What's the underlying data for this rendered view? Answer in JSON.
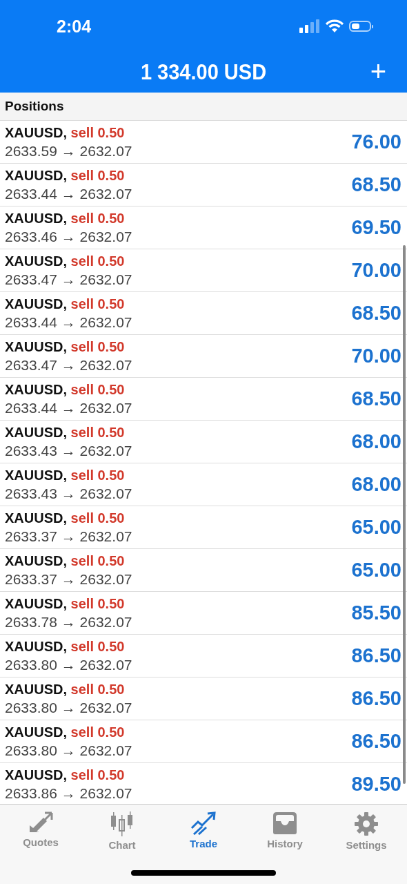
{
  "status_bar": {
    "time": "2:04"
  },
  "header": {
    "title": "1 334.00 USD",
    "add_button": "+"
  },
  "section_title": "Positions",
  "positions": [
    {
      "symbol": "XAUUSD,",
      "order": "sell 0.50",
      "prices": "2633.59 → 2632.07",
      "profit": "76.00"
    },
    {
      "symbol": "XAUUSD,",
      "order": "sell 0.50",
      "prices": "2633.44 → 2632.07",
      "profit": "68.50"
    },
    {
      "symbol": "XAUUSD,",
      "order": "sell 0.50",
      "prices": "2633.46 → 2632.07",
      "profit": "69.50"
    },
    {
      "symbol": "XAUUSD,",
      "order": "sell 0.50",
      "prices": "2633.47 → 2632.07",
      "profit": "70.00"
    },
    {
      "symbol": "XAUUSD,",
      "order": "sell 0.50",
      "prices": "2633.44 → 2632.07",
      "profit": "68.50"
    },
    {
      "symbol": "XAUUSD,",
      "order": "sell 0.50",
      "prices": "2633.47 → 2632.07",
      "profit": "70.00"
    },
    {
      "symbol": "XAUUSD,",
      "order": "sell 0.50",
      "prices": "2633.44 → 2632.07",
      "profit": "68.50"
    },
    {
      "symbol": "XAUUSD,",
      "order": "sell 0.50",
      "prices": "2633.43 → 2632.07",
      "profit": "68.00"
    },
    {
      "symbol": "XAUUSD,",
      "order": "sell 0.50",
      "prices": "2633.43 → 2632.07",
      "profit": "68.00"
    },
    {
      "symbol": "XAUUSD,",
      "order": "sell 0.50",
      "prices": "2633.37 → 2632.07",
      "profit": "65.00"
    },
    {
      "symbol": "XAUUSD,",
      "order": "sell 0.50",
      "prices": "2633.37 → 2632.07",
      "profit": "65.00"
    },
    {
      "symbol": "XAUUSD,",
      "order": "sell 0.50",
      "prices": "2633.78 → 2632.07",
      "profit": "85.50"
    },
    {
      "symbol": "XAUUSD,",
      "order": "sell 0.50",
      "prices": "2633.80 → 2632.07",
      "profit": "86.50"
    },
    {
      "symbol": "XAUUSD,",
      "order": "sell 0.50",
      "prices": "2633.80 → 2632.07",
      "profit": "86.50"
    },
    {
      "symbol": "XAUUSD,",
      "order": "sell 0.50",
      "prices": "2633.80 → 2632.07",
      "profit": "86.50"
    },
    {
      "symbol": "XAUUSD,",
      "order": "sell 0.50",
      "prices": "2633.86 → 2632.07",
      "profit": "89.50"
    }
  ],
  "tabs": [
    {
      "kind": "quotes",
      "label": "Quotes",
      "selected": false
    },
    {
      "kind": "chart",
      "label": "Chart",
      "selected": false
    },
    {
      "kind": "trade",
      "label": "Trade",
      "selected": true
    },
    {
      "kind": "history",
      "label": "History",
      "selected": false
    },
    {
      "kind": "settings",
      "label": "Settings",
      "selected": false
    }
  ]
}
